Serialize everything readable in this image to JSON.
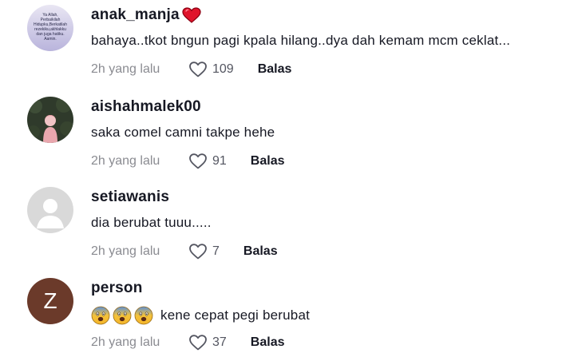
{
  "comments": [
    {
      "username": "anak_manja",
      "text": "bahaya..tkot bngun pagi kpala hilang..dya dah kemam mcm ceklat...",
      "time": "2h yang lalu",
      "likes": "109",
      "reply": "Balas",
      "avatar_lines": [
        "Ya Allah,",
        "Perbaikilah",
        "Hidupku,Berkatilah",
        "rezekiku,akhlakku",
        "dan juga hatiku.",
        "Aamin."
      ]
    },
    {
      "username": "aishahmalek00",
      "text": "saka comel camni takpe hehe",
      "time": "2h yang lalu",
      "likes": "91",
      "reply": "Balas"
    },
    {
      "username": "setiawanis",
      "text": "dia berubat tuuu.....",
      "time": "2h yang lalu",
      "likes": "7",
      "reply": "Balas"
    },
    {
      "username": "person",
      "text": "kene cepat pegi berubat",
      "time": "2h yang lalu",
      "likes": "37",
      "reply": "Balas",
      "avatar_letter": "Z",
      "emojis": [
        "fearful-face-emoji",
        "fearful-face-emoji",
        "fearful-face-emoji"
      ]
    }
  ],
  "colors": {
    "username": "#161823",
    "text": "#161823",
    "time": "#8a8b91",
    "like_count": "#545661",
    "avatar_z_bg": "#6b3a2a",
    "default_avatar_bg": "#d9d9d9"
  },
  "icons": {
    "heart_outline": "heart-outline-icon",
    "red_heart_emoji": "red-heart-emoji"
  }
}
